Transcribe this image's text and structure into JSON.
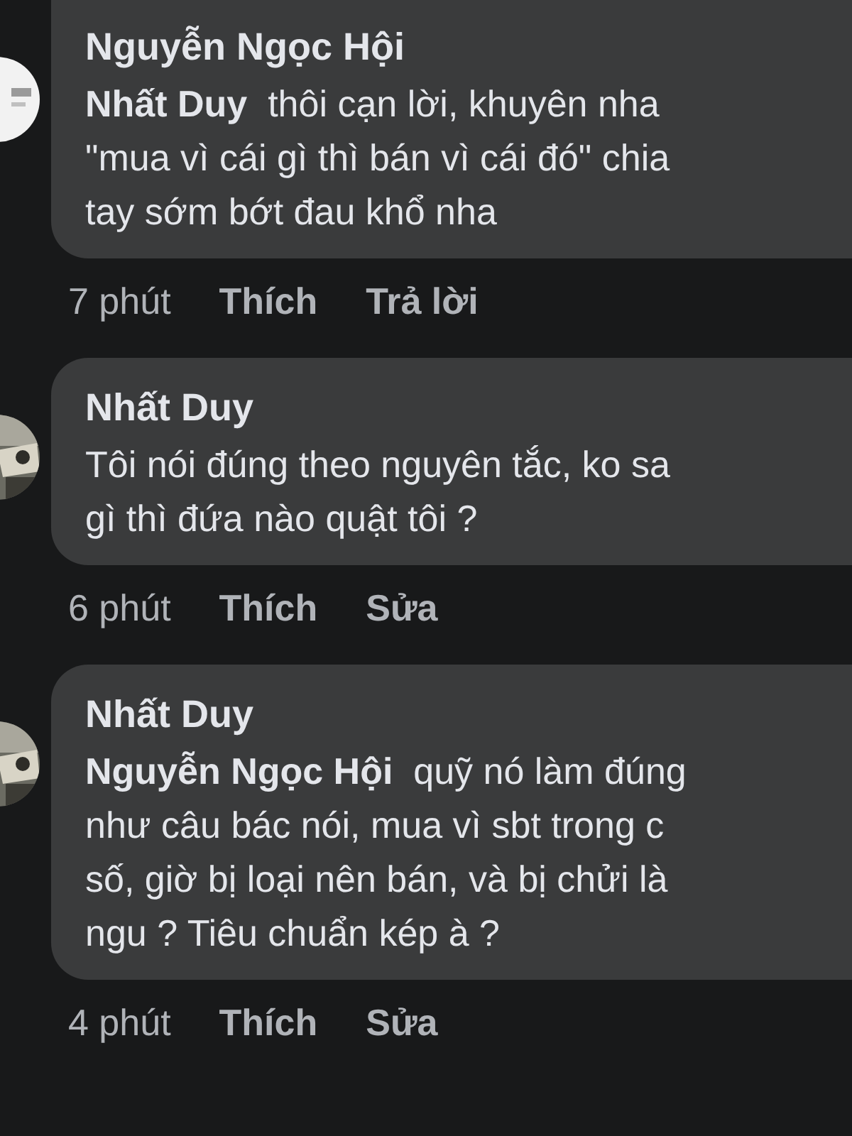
{
  "comments": [
    {
      "author": "Nguyễn Ngọc Hội",
      "avatar": {
        "kind": "picture"
      },
      "text": "**Nhất Duy**  thôi cạn lời, khuyên nha\n\"mua vì cái gì thì bán vì cái đó\" chia\ntay sớm bớt đau khổ nha",
      "time": "7 phút",
      "actions": [
        "Thích",
        "Trả lời"
      ]
    },
    {
      "author": "Nhất Duy",
      "avatar": {
        "kind": "picture"
      },
      "text": "Tôi nói đúng theo nguyên tắc, ko sa\ngì thì đứa nào quật tôi ?",
      "time": "6 phút",
      "actions": [
        "Thích",
        "Sửa"
      ]
    },
    {
      "author": "Nhất Duy",
      "avatar": {
        "kind": "picture"
      },
      "text": "**Nguyễn Ngọc Hội**  quỹ nó làm đúng\nnhư câu bác nói, mua vì sbt trong c\nsố, giờ bị loại nên bán, và bị chửi là\nngu ? Tiêu chuẩn kép à ?",
      "time": "4 phút",
      "actions": [
        "Thích",
        "Sửa"
      ]
    }
  ]
}
